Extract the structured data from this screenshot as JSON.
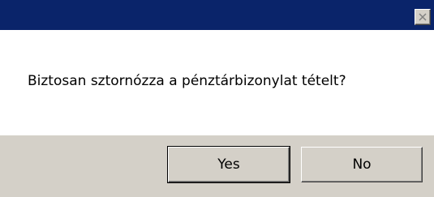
{
  "dialog": {
    "title": "",
    "message": "Biztosan sztornózza a pénztárbizonylat tételt?",
    "close_icon": "close-icon",
    "buttons": {
      "yes_label": "Yes",
      "no_label": "No"
    }
  },
  "colors": {
    "titlebar": "#0a246a",
    "footer": "#d4d0c8",
    "button_face": "#d4d0c8",
    "content_background": "#ffffff"
  }
}
